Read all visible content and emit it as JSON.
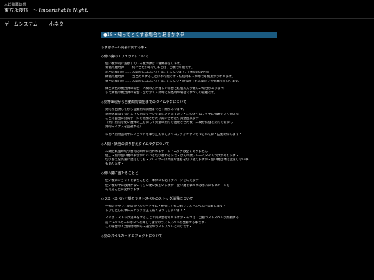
{
  "header": {
    "subtitle": "人妖弾幕幻想",
    "title": "東方永夜抄",
    "title_en": "～ Imperishable Night."
  },
  "breadcrumb": {
    "category": "ゲームシステム",
    "page": "小ネタ"
  },
  "section": {
    "heading": "●15・知ってとくする場合もあるかネタ"
  },
  "intro": "まずはゲーム内部に関する事・",
  "topics": [
    {
      "title": "◇使い魔のエフェクトについて",
      "lines": [
        "使い魔が何に置換している魔力弾は３種類存在します。",
        "青色の魔力弾 …… 何に当たりもなしもとは、自機で可能です。",
        "赤色の魔力弾 …… 人間時に当当たりすることになります。（妖怪時は不可）",
        "緑色の魔力弾 …… 当当たりすることは不可能です・妖怪時も人間時でも使用がかわります。",
        "黄色の魔力弾 …… 人間時に当当たりすることになり・妖怪時でも人間時でも弾幕が変わります。",
        "",
        "緑と黄色の魔力弾の場合・人間の方が難しい場合と妖怪の方が難しい場合があります。",
        "また青色の魔力弾の場合・全ながて人間時と妖怪時の場合ですべての避難です。"
      ]
    },
    {
      "title": "◇刻符出現から自動刻得開始までのタイムラグについて",
      "lines": [
        "刻符が出現してから自動刻得開始まで若干間があります。",
        "刻符を取得すると大きく刻得ゲージを変化させますので・このタイムラグ中に弾幕を切り替える",
        "ことで自由に刻得ゲージを増加させたり減少させたり調整出来ます・",
        "（例：刻符を使い魔弾の王を得して大量の刻符を出現させた後・人間か妖怪と刻符を取得し・",
        "刻得マイナスを回避する）",
        "",
        "なお・刻符出現中にショットを撃ち止めるとタイムラグがキャンセルされて即・自動刻得します・"
      ]
    },
    {
      "title": "◇人間・妖怪の切り替えタイムラグについて",
      "lines": [
        "人間と妖怪の切り替えは瞬時に行われます・タイムラグは全くありません・",
        "但し・刻の使い魔の表示がバババと切り替わるまで・ほんの数フレームタイムラグがあります・",
        "切り替えを高速に連打しても・プレイヤーは高速な連打を切り替えますが・使い魔自体は変化しない事",
        "もあります・"
      ]
    },
    {
      "title": "◇使い魔に当たることと",
      "lines": [
        "使い魔にショットを撃ちこむと・本体にも若干ダメージを与えます・",
        "使い魔の中には弾かないくらい硬い奴もいますが・使い魔を撃つ事はボスにもダメージを",
        "与えることに変わります・"
      ]
    },
    {
      "title": "◇ラストスペルと刻のラストスペルのストック消費について",
      "lines": [
        "一部のキャラと刻のスペルカード中は・被弾しても自動でラストスペルが発動します・",
        "しかし世した事にストックが全て無くなってしまいます・",
        "",
        "マイボ・ストック消費をすることで再試合行ありますが・それは・自動ラストスペルが発動する",
        "前にスペルカードボタンを押して通常のラストスペルを発動する事です・",
        "この場合の人力受付時間も・通常のラストスペルと同じです・"
      ]
    },
    {
      "title": "◇刻のスペルカードエフェクトについて",
      "lines": []
    }
  ]
}
